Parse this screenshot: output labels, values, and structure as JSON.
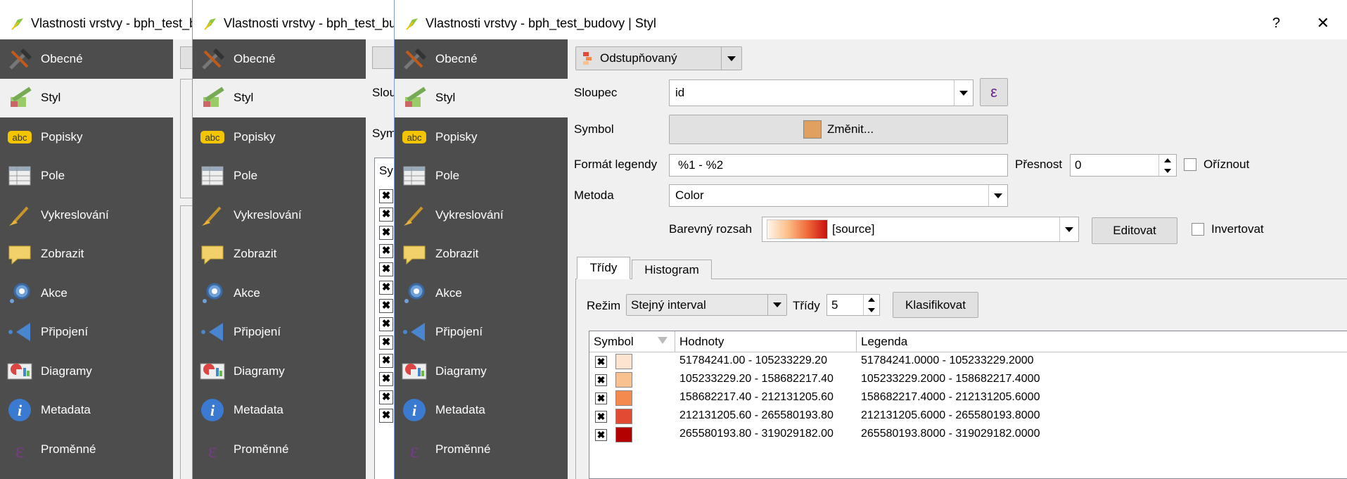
{
  "windows": [
    {
      "title": "Vlastnosti vrstvy - bph_test_budovy | Obecné"
    },
    {
      "title": "Vlastnosti vrstvy - bph_test_budovy | Styl"
    },
    {
      "title": "Vlastnosti vrstvy - bph_test_budovy | Styl"
    }
  ],
  "sidebar": {
    "items": [
      {
        "label": "Obecné",
        "icon": "general-icon"
      },
      {
        "label": "Styl",
        "icon": "style-icon"
      },
      {
        "label": "Popisky",
        "icon": "labels-icon"
      },
      {
        "label": "Pole",
        "icon": "fields-icon"
      },
      {
        "label": "Vykreslování",
        "icon": "rendering-icon"
      },
      {
        "label": "Zobrazit",
        "icon": "display-icon"
      },
      {
        "label": "Akce",
        "icon": "actions-icon"
      },
      {
        "label": "Připojení",
        "icon": "joins-icon"
      },
      {
        "label": "Diagramy",
        "icon": "diagrams-icon"
      },
      {
        "label": "Metadata",
        "icon": "metadata-icon"
      },
      {
        "label": "Proměnné",
        "icon": "variables-icon"
      }
    ]
  },
  "mid_window": {
    "sloupec_cut": "Slou",
    "symbol_cut": "Sym",
    "header_cut": "Sy"
  },
  "controls": {
    "help": "?",
    "close": "✕"
  },
  "renderer": {
    "label": "Odstupňovaný"
  },
  "column": {
    "label": "Sloupec",
    "value": "id",
    "expr_glyph": "ε"
  },
  "symbol": {
    "label": "Symbol",
    "button": "Změnit...",
    "color": "#e0a060"
  },
  "legend_format": {
    "label": "Formát legendy",
    "value": "%1 - %2",
    "precision_label": "Přesnost",
    "precision_value": "0",
    "trim_label": "Oříznout"
  },
  "method": {
    "label": "Metoda",
    "value": "Color"
  },
  "color_ramp": {
    "label": "Barevný rozsah",
    "value": "[source]",
    "edit": "Editovat",
    "invert": "Invertovat"
  },
  "tabs": {
    "classes": "Třídy",
    "histogram": "Histogram"
  },
  "mode": {
    "label": "Režim",
    "value": "Stejný interval",
    "classes_label": "Třídy",
    "classes_value": "5",
    "classify": "Klasifikovat"
  },
  "table": {
    "headers": [
      "Symbol",
      "Hodnoty",
      "Legenda"
    ],
    "rows": [
      {
        "values": "51784241.00 - 105233229.20",
        "legend": "51784241.0000 - 105233229.2000",
        "color": "#fde4d0"
      },
      {
        "values": "105233229.20 - 158682217.40",
        "legend": "105233229.2000 - 158682217.4000",
        "color": "#f9c18f"
      },
      {
        "values": "158682217.40 - 212131205.60",
        "legend": "158682217.4000 - 212131205.6000",
        "color": "#f58a4e"
      },
      {
        "values": "212131205.60 - 265580193.80",
        "legend": "212131205.6000 - 265580193.8000",
        "color": "#e34a33"
      },
      {
        "values": "265580193.80 - 319029182.00",
        "legend": "265580193.8000 - 319029182.0000",
        "color": "#b30000"
      }
    ]
  }
}
